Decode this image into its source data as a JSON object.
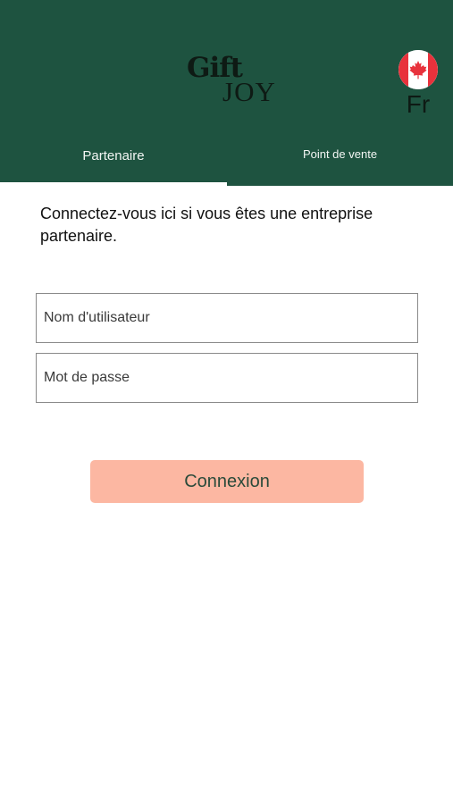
{
  "brand": {
    "logo_line1": "Gift",
    "logo_line2": "JOY"
  },
  "language": {
    "label": "Fr",
    "flag_icon": "canada-flag-icon"
  },
  "tabs": [
    {
      "label": "Partenaire",
      "active": true
    },
    {
      "label": "Point de vente",
      "active": false
    }
  ],
  "form": {
    "intro": "Connectez-vous ici si vous êtes une entreprise partenaire.",
    "username_placeholder": "Nom d'utilisateur",
    "password_placeholder": "Mot de passe",
    "submit_label": "Connexion"
  },
  "colors": {
    "header_bg": "#1e5340",
    "button_bg": "#fcb7a2",
    "button_text": "#2a4a3a"
  }
}
